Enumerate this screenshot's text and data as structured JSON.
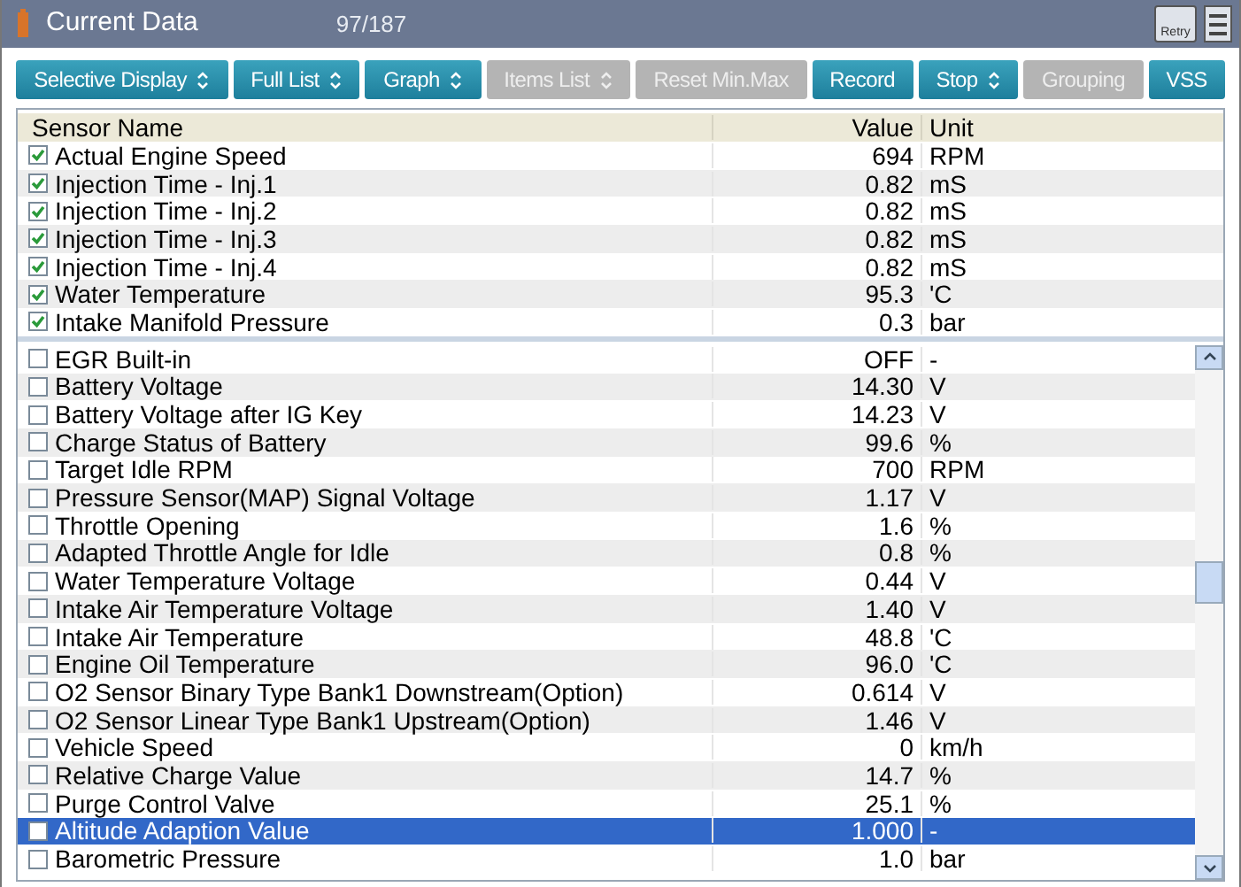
{
  "window": {
    "title": "Current Data",
    "count": "97/187",
    "retry": "Retry"
  },
  "toolbar": [
    {
      "label": "Selective Display",
      "dropdown": true,
      "disabled": false
    },
    {
      "label": "Full List",
      "dropdown": true,
      "disabled": false
    },
    {
      "label": "Graph",
      "dropdown": true,
      "disabled": false
    },
    {
      "label": "Items List",
      "dropdown": true,
      "disabled": true
    },
    {
      "label": "Reset Min.Max",
      "dropdown": false,
      "disabled": true
    },
    {
      "label": "Record",
      "dropdown": false,
      "disabled": false
    },
    {
      "label": "Stop",
      "dropdown": true,
      "disabled": false
    },
    {
      "label": "Grouping",
      "dropdown": false,
      "disabled": true
    },
    {
      "label": "VSS",
      "dropdown": false,
      "disabled": false
    }
  ],
  "table": {
    "columns": [
      "Sensor Name",
      "Value",
      "Unit"
    ],
    "pinned_rows": [
      {
        "name": "Actual Engine Speed",
        "value": "694",
        "unit": "RPM",
        "checked": true,
        "selected": false
      },
      {
        "name": "Injection Time - Inj.1",
        "value": "0.82",
        "unit": "mS",
        "checked": true,
        "selected": false
      },
      {
        "name": "Injection Time - Inj.2",
        "value": "0.82",
        "unit": "mS",
        "checked": true,
        "selected": false
      },
      {
        "name": "Injection Time - Inj.3",
        "value": "0.82",
        "unit": "mS",
        "checked": true,
        "selected": false
      },
      {
        "name": "Injection Time - Inj.4",
        "value": "0.82",
        "unit": "mS",
        "checked": true,
        "selected": false
      },
      {
        "name": "Water Temperature",
        "value": "95.3",
        "unit": "'C",
        "checked": true,
        "selected": false
      },
      {
        "name": "Intake Manifold Pressure",
        "value": "0.3",
        "unit": "bar",
        "checked": true,
        "selected": false
      }
    ],
    "rows": [
      {
        "name": "EGR Built-in",
        "value": "OFF",
        "unit": "-",
        "checked": false,
        "selected": false
      },
      {
        "name": "Battery Voltage",
        "value": "14.30",
        "unit": "V",
        "checked": false,
        "selected": false
      },
      {
        "name": "Battery Voltage after IG Key",
        "value": "14.23",
        "unit": "V",
        "checked": false,
        "selected": false
      },
      {
        "name": "Charge Status of Battery",
        "value": "99.6",
        "unit": "%",
        "checked": false,
        "selected": false
      },
      {
        "name": "Target Idle RPM",
        "value": "700",
        "unit": "RPM",
        "checked": false,
        "selected": false
      },
      {
        "name": "Pressure Sensor(MAP) Signal Voltage",
        "value": "1.17",
        "unit": "V",
        "checked": false,
        "selected": false
      },
      {
        "name": "Throttle Opening",
        "value": "1.6",
        "unit": "%",
        "checked": false,
        "selected": false
      },
      {
        "name": "Adapted Throttle Angle for Idle",
        "value": "0.8",
        "unit": "%",
        "checked": false,
        "selected": false
      },
      {
        "name": "Water Temperature Voltage",
        "value": "0.44",
        "unit": "V",
        "checked": false,
        "selected": false
      },
      {
        "name": "Intake Air Temperature Voltage",
        "value": "1.40",
        "unit": "V",
        "checked": false,
        "selected": false
      },
      {
        "name": "Intake Air Temperature",
        "value": "48.8",
        "unit": "'C",
        "checked": false,
        "selected": false
      },
      {
        "name": "Engine Oil Temperature",
        "value": "96.0",
        "unit": "'C",
        "checked": false,
        "selected": false
      },
      {
        "name": "O2 Sensor Binary Type Bank1 Downstream(Option)",
        "value": "0.614",
        "unit": "V",
        "checked": false,
        "selected": false
      },
      {
        "name": "O2 Sensor Linear Type Bank1 Upstream(Option)",
        "value": "1.46",
        "unit": "V",
        "checked": false,
        "selected": false
      },
      {
        "name": "Vehicle Speed",
        "value": "0",
        "unit": "km/h",
        "checked": false,
        "selected": false
      },
      {
        "name": "Relative Charge Value",
        "value": "14.7",
        "unit": "%",
        "checked": false,
        "selected": false
      },
      {
        "name": "Purge Control Valve",
        "value": "25.1",
        "unit": "%",
        "checked": false,
        "selected": false
      },
      {
        "name": "Altitude Adaption Value",
        "value": "1.000",
        "unit": "-",
        "checked": false,
        "selected": true
      },
      {
        "name": "Barometric Pressure",
        "value": "1.0",
        "unit": "bar",
        "checked": false,
        "selected": false
      }
    ]
  }
}
